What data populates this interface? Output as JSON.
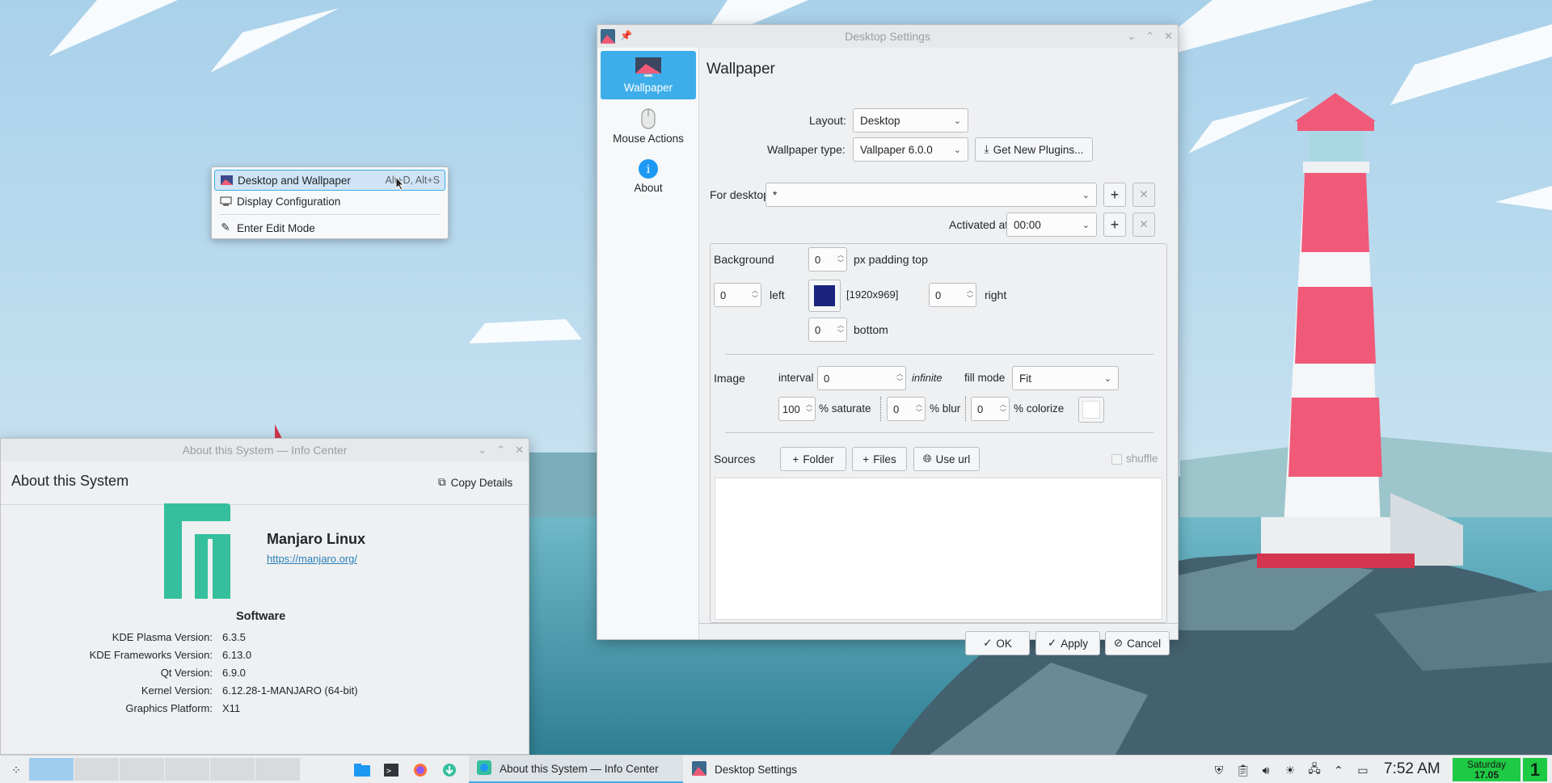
{
  "context_menu": {
    "items": [
      {
        "label": "Desktop and Wallpaper",
        "shortcut": "Alt+D, Alt+S",
        "icon": "wallpaper-icon"
      },
      {
        "label": "Display Configuration",
        "shortcut": "",
        "icon": "monitor-icon"
      },
      {
        "label": "Enter Edit Mode",
        "shortcut": "",
        "icon": "pencil-icon"
      }
    ]
  },
  "desktop_settings": {
    "title": "Desktop Settings",
    "sidebar": [
      {
        "label": "Wallpaper",
        "icon": "wallpaper-icon"
      },
      {
        "label": "Mouse Actions",
        "icon": "mouse-icon"
      },
      {
        "label": "About",
        "icon": "info-icon"
      }
    ],
    "heading": "Wallpaper",
    "layout_label": "Layout:",
    "layout_value": "Desktop",
    "wallpaper_type_label": "Wallpaper type:",
    "wallpaper_type_value": "Vallpaper 6.0.0",
    "get_new_plugins": "Get New Plugins...",
    "for_desktop_label": "For desktop",
    "for_desktop_value": "*",
    "activated_at_label": "Activated at",
    "activated_at_value": "00:00",
    "background_label": "Background",
    "padding_top": "0",
    "padding_top_label": "px padding top",
    "padding_left": "0",
    "padding_left_label": "left",
    "bg_color": "#1a237e",
    "resolution": "[1920x969]",
    "padding_right": "0",
    "padding_right_label": "right",
    "padding_bottom": "0",
    "padding_bottom_label": "bottom",
    "image_label": "Image",
    "interval_label": "interval",
    "interval_value": "0",
    "interval_suffix": "infinite",
    "fill_mode_label": "fill mode",
    "fill_mode_value": "Fit",
    "saturate_value": "100",
    "saturate_label": "% saturate",
    "blur_value": "0",
    "blur_label": "% blur",
    "colorize_value": "0",
    "colorize_label": "% colorize",
    "sources_label": "Sources",
    "folder_btn": "Folder",
    "files_btn": "Files",
    "use_url_btn": "Use url",
    "shuffle_label": "shuffle",
    "ok": "OK",
    "apply": "Apply",
    "cancel": "Cancel"
  },
  "info_center": {
    "title": "About this System — Info Center",
    "heading": "About this System",
    "copy_details": "Copy Details",
    "distro": "Manjaro Linux",
    "url": "https://manjaro.org/",
    "section": "Software",
    "rows": [
      {
        "k": "KDE Plasma Version:",
        "v": "6.3.5"
      },
      {
        "k": "KDE Frameworks Version:",
        "v": "6.13.0"
      },
      {
        "k": "Qt Version:",
        "v": "6.9.0"
      },
      {
        "k": "Kernel Version:",
        "v": "6.12.28-1-MANJARO (64-bit)"
      },
      {
        "k": "Graphics Platform:",
        "v": "X11"
      }
    ]
  },
  "taskbar": {
    "tasks": [
      {
        "label": "About this System  — Info Center"
      },
      {
        "label": "Desktop Settings"
      }
    ],
    "clock": "7:52 AM",
    "date_day": "Saturday",
    "date_num": "17.05",
    "desktop_num": "1"
  },
  "colors": {
    "accent": "#3daee9",
    "manjaro": "#35bf9d"
  }
}
